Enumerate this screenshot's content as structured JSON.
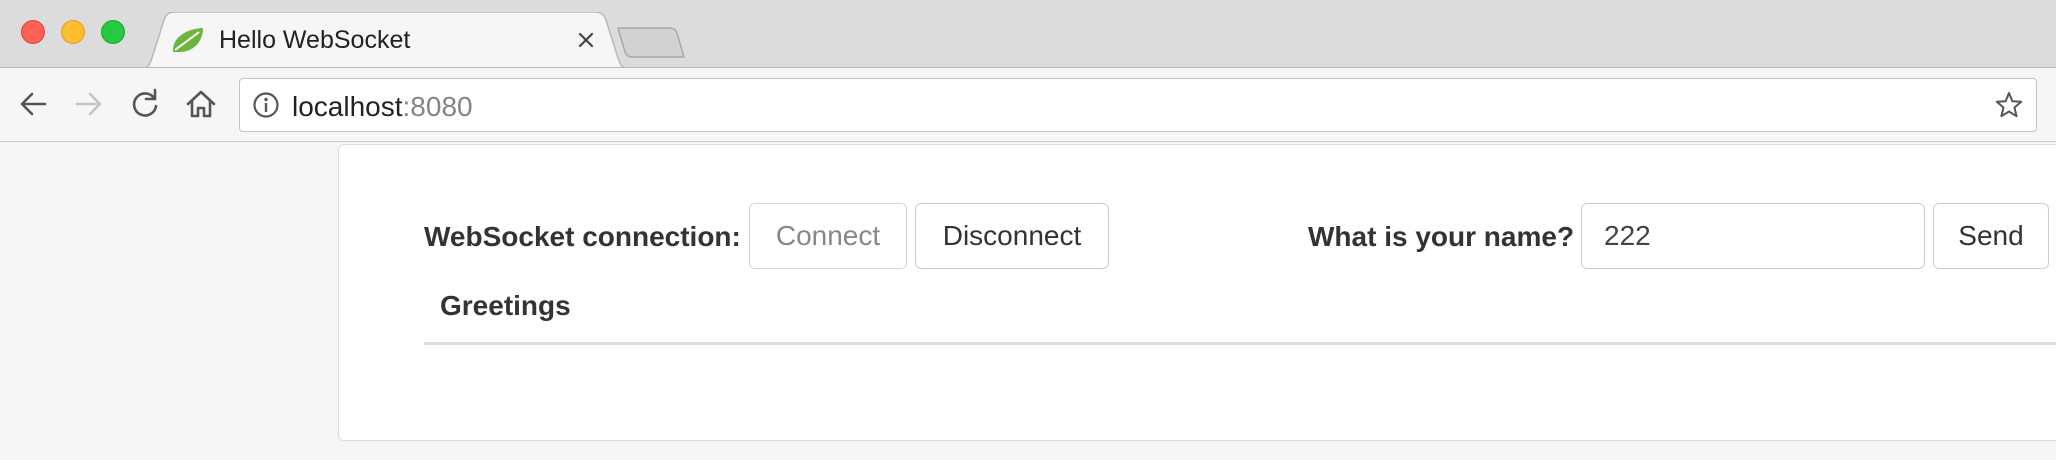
{
  "browser": {
    "tab": {
      "title": "Hello WebSocket",
      "favicon": "spring-leaf-icon"
    },
    "address_bar": {
      "host": "localhost",
      "port": ":8080"
    },
    "icons": {
      "back": "arrow-left-icon",
      "forward": "arrow-right-icon",
      "reload": "reload-icon",
      "home": "home-icon",
      "info": "info-icon",
      "bookmark": "star-icon",
      "tab_close": "close-icon"
    },
    "forward_enabled": false
  },
  "page": {
    "connection_label": "WebSocket connection:",
    "connect_button": "Connect",
    "connect_enabled": false,
    "disconnect_button": "Disconnect",
    "name_label": "What is your name?",
    "name_value": "222",
    "send_button": "Send",
    "greetings_header": "Greetings"
  },
  "colors": {
    "traffic_close": "#fe5f57",
    "traffic_minimize": "#febc2e",
    "traffic_maximize": "#28c840",
    "favicon_green": "#6db33f"
  }
}
